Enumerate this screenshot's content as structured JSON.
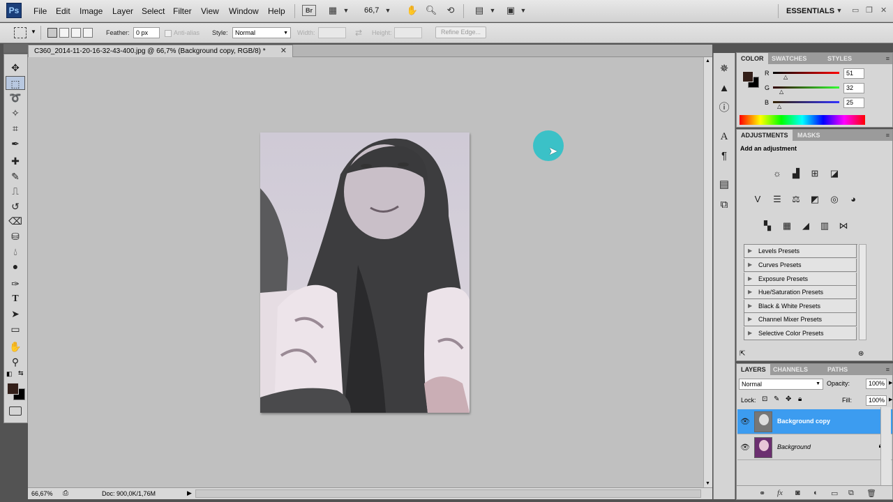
{
  "app": {
    "logo": "Ps",
    "workspace": "ESSENTIALS"
  },
  "menus": [
    "File",
    "Edit",
    "Image",
    "Layer",
    "Select",
    "Filter",
    "View",
    "Window",
    "Help"
  ],
  "menubar": {
    "bridge_label": "Br",
    "zoom": "66,7"
  },
  "options": {
    "feather_label": "Feather:",
    "feather_value": "0 px",
    "antialias_label": "Anti-alias",
    "style_label": "Style:",
    "style_value": "Normal",
    "width_label": "Width:",
    "height_label": "Height:",
    "refine_label": "Refine Edge..."
  },
  "document": {
    "tab_title": "C360_2014-11-20-16-32-43-400.jpg @ 66,7% (Background copy, RGB/8) *"
  },
  "status": {
    "zoom": "66,67%",
    "doc": "Doc: 900,0K/1,76M"
  },
  "color_panel": {
    "tabs": [
      "COLOR",
      "SWATCHES",
      "STYLES"
    ],
    "r_label": "R",
    "g_label": "G",
    "b_label": "B",
    "r": "51",
    "g": "32",
    "b": "25",
    "fg_color": "#331f19",
    "bg_color": "#000000"
  },
  "adjustments_panel": {
    "tabs": [
      "ADJUSTMENTS",
      "MASKS"
    ],
    "heading": "Add an adjustment",
    "presets": [
      "Levels Presets",
      "Curves Presets",
      "Exposure Presets",
      "Hue/Saturation Presets",
      "Black & White Presets",
      "Channel Mixer Presets",
      "Selective Color Presets"
    ]
  },
  "layers_panel": {
    "tabs": [
      "LAYERS",
      "CHANNELS",
      "PATHS"
    ],
    "blend_mode": "Normal",
    "opacity_label": "Opacity:",
    "opacity": "100%",
    "lock_label": "Lock:",
    "fill_label": "Fill:",
    "fill": "100%",
    "layers": [
      {
        "name": "Background copy",
        "selected": true
      },
      {
        "name": "Background",
        "selected": false
      }
    ]
  },
  "accent_color": "#3c9cf0"
}
